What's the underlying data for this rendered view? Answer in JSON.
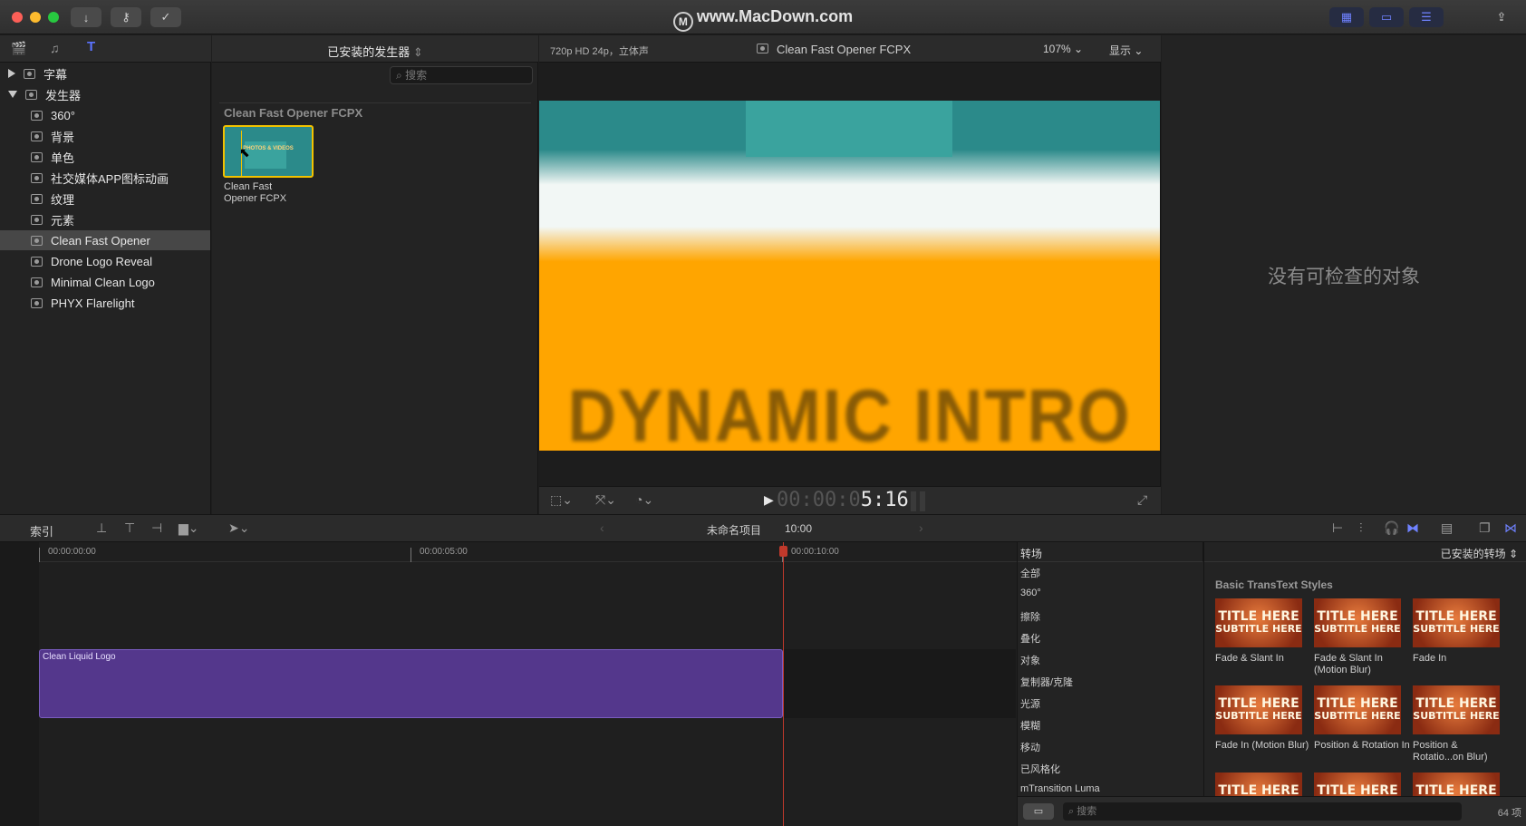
{
  "window": {
    "watermark": "www.MacDown.com"
  },
  "titlebar": {
    "buttons": [
      "import-icon",
      "keyword-icon",
      "check-icon"
    ],
    "right_icons": [
      "grid-layout-icon",
      "timeline-layout-icon",
      "inspector-toggle-icon",
      "share-icon"
    ]
  },
  "library": {
    "toolbar_icons": [
      "clapper-icon",
      "music-icon",
      "titles-generators-icon"
    ],
    "browser_title": "已安装的发生器",
    "items": [
      {
        "label": "字幕",
        "expand": "collapsed",
        "level": 0
      },
      {
        "label": "发生器",
        "expand": "expanded",
        "level": 0
      },
      {
        "label": "360°",
        "level": 1
      },
      {
        "label": "背景",
        "level": 1
      },
      {
        "label": "单色",
        "level": 1
      },
      {
        "label": "社交媒体APP图标动画",
        "level": 1
      },
      {
        "label": "纹理",
        "level": 1
      },
      {
        "label": "元素",
        "level": 1
      },
      {
        "label": "Clean Fast Opener",
        "level": 1,
        "selected": true
      },
      {
        "label": "Drone Logo Reveal",
        "level": 1
      },
      {
        "label": "Minimal Clean Logo",
        "level": 1
      },
      {
        "label": "PHYX Flarelight",
        "level": 1
      }
    ]
  },
  "browser": {
    "search_placeholder": "搜索",
    "section_title": "Clean Fast Opener FCPX",
    "clip_thumb_text": "PHOTOS & VIDEOS",
    "clip_name": "Clean Fast Opener FCPX"
  },
  "viewer": {
    "format": "720p HD 24p，立体声",
    "title": "Clean Fast Opener FCPX",
    "zoom": "107%",
    "display_label": "显示",
    "frame_text": "DYNAMIC INTRO",
    "timecode_dim": "00:00:0",
    "timecode": "5:16",
    "colors": {
      "teal": "#2b8a8a",
      "white": "#f2f7f5",
      "orange": "#ffa500"
    }
  },
  "inspector": {
    "empty_text": "没有可检查的对象"
  },
  "timeline": {
    "index_label": "索引",
    "project_name": "未命名项目",
    "duration": "10:00",
    "ruler": [
      "00:00:00:00",
      "00:00:05:00",
      "00:00:10:00"
    ],
    "clip": {
      "label": "Clean Liquid Logo",
      "color": "#54378c"
    }
  },
  "transitions": {
    "header": "转场",
    "installed_label": "已安装的转场",
    "categories": [
      "全部",
      "360°",
      "擦除",
      "叠化",
      "对象",
      "复制器/克隆",
      "光源",
      "模糊",
      "移动",
      "已风格化",
      "mTransition Luma"
    ],
    "group_title": "Basic TransText Styles",
    "thumb_title": "TITLE HERE",
    "thumb_subtitle": "SUBTITLE HERE",
    "items": [
      {
        "label": "Fade & Slant In"
      },
      {
        "label": "Fade & Slant In (Motion Blur)"
      },
      {
        "label": "Fade In"
      },
      {
        "label": "Fade In (Motion Blur)"
      },
      {
        "label": "Position & Rotation In"
      },
      {
        "label": "Position & Rotatio...on Blur)"
      }
    ],
    "search_placeholder": "搜索",
    "count": "64 项"
  }
}
